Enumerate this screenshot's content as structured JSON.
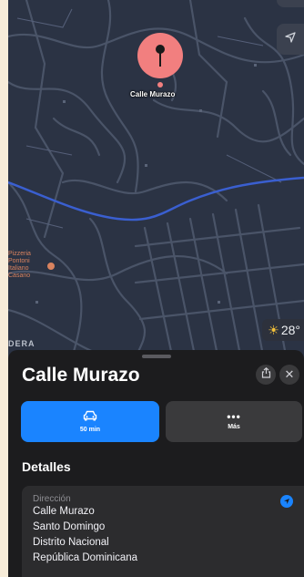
{
  "map": {
    "pin_label": "Calle Murazo",
    "poi_lines": [
      "Pizzeria",
      "Pontoni",
      "Italiano",
      "Casano"
    ],
    "edge_label": "DERA",
    "weather": {
      "temperature": "28°",
      "icon": "sun-icon"
    },
    "icons": {
      "locate": "location-arrow-icon",
      "pin": "map-pin-icon"
    }
  },
  "sheet": {
    "title": "Calle Murazo",
    "actions": {
      "drive": {
        "label": "50 min",
        "icon": "car-icon"
      },
      "more": {
        "label": "Más",
        "icon": "ellipsis-icon"
      }
    },
    "section_title": "Detalles",
    "address": {
      "label": "Dirección",
      "lines": [
        "Calle Murazo",
        "Santo Domingo",
        "Distrito Nacional",
        "República Dominicana"
      ]
    }
  },
  "colors": {
    "accent": "#1a84ff",
    "pin": "#f27f7f",
    "sheet_bg": "#1c1c1e",
    "map_bg": "#2b3344"
  }
}
